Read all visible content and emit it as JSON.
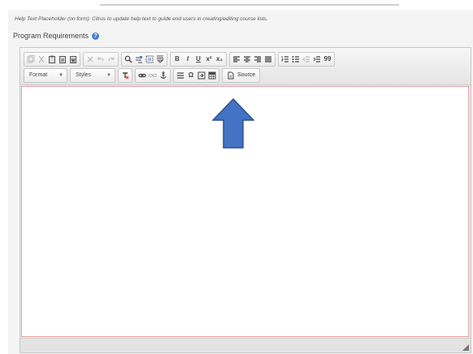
{
  "help_text": "Help Text Placeholder (on form): Citrus to update help text to guide end users in creating/editing course lists.",
  "field_label": "Program Requirements",
  "toolbar": {
    "format_label": "Format",
    "styles_label": "Styles",
    "source_label": "Source",
    "bold_glyph": "B",
    "italic_glyph": "I",
    "underline_glyph": "U",
    "superscript_glyph": "x²",
    "subscript_glyph": "x₂",
    "special_char_glyph": "Ω",
    "blockquote_glyph": "99"
  },
  "colors": {
    "arrow_fill": "#4472c4",
    "arrow_stroke": "#2f528f",
    "content_border": "#e7a5a5",
    "help_icon": "#4a7fd4"
  }
}
